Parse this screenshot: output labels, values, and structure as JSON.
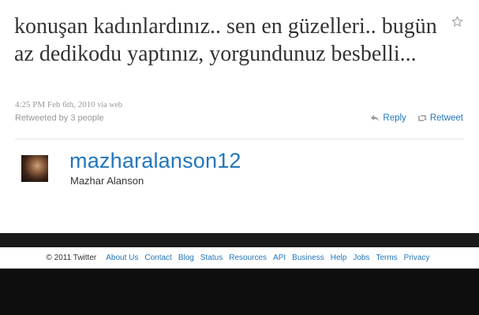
{
  "tweet": {
    "text": "konuşan kadınlardınız.. sen en güzelleri.. bugün az dedikodu yaptınız, yorgundunuz besbelli...",
    "timestamp": "4:25 PM Feb 6th, 2010",
    "via": "via web",
    "retweeted_by": "Retweeted by 3 people",
    "reply_label": "Reply",
    "retweet_label": "Retweet",
    "favorite_icon": "star-icon"
  },
  "user": {
    "screen_name": "mazharalanson12",
    "full_name": "Mazhar Alanson"
  },
  "footer": {
    "copyright": "© 2011 Twitter",
    "links": [
      "About Us",
      "Contact",
      "Blog",
      "Status",
      "Resources",
      "API",
      "Business",
      "Help",
      "Jobs",
      "Terms",
      "Privacy"
    ]
  },
  "colors": {
    "link": "#2276bb",
    "text": "#333333",
    "muted": "#999999"
  }
}
